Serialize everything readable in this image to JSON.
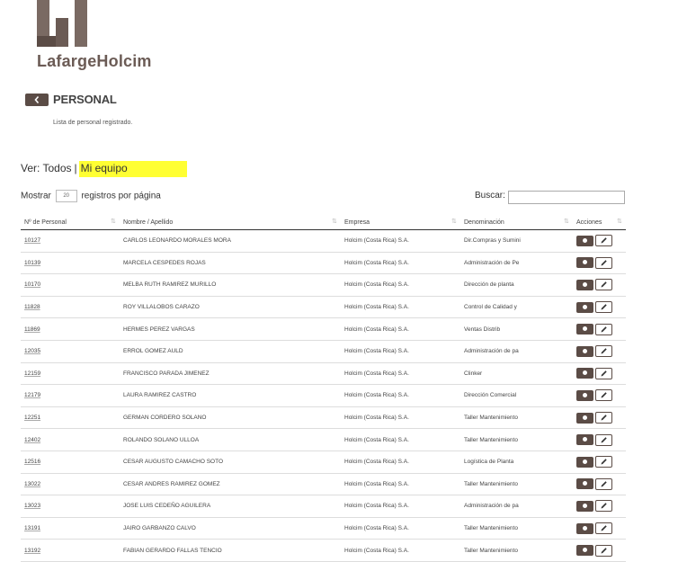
{
  "brand": {
    "name": "LafargeHolcim",
    "color": "#6b5b55",
    "accent": "#5b4c46"
  },
  "header": {
    "back_icon": "chevron-left-icon",
    "title": "PERSONAL",
    "subtitle": "Lista de personal registrado."
  },
  "filter": {
    "prefix": "Ver:",
    "all": "Todos",
    "separator": "|",
    "mine": "Mi equipo",
    "highlight": "#ffff33"
  },
  "length": {
    "before": "Mostrar",
    "value": "20",
    "after": "registros por página"
  },
  "search": {
    "label": "Buscar:",
    "value": ""
  },
  "table": {
    "columns": [
      "Nº de Personal",
      "Nombre / Apellido",
      "Empresa",
      "Denominación",
      "Acciones"
    ],
    "rows": [
      {
        "id": "10127",
        "name": "CARLOS LEONARDO MORALES MORA",
        "company": "Holcim (Costa Rica) S.A.",
        "denom": "Dir.Compras y Sumini"
      },
      {
        "id": "10139",
        "name": "MARCELA CESPEDES ROJAS",
        "company": "Holcim (Costa Rica) S.A.",
        "denom": "Administración de Pe"
      },
      {
        "id": "10170",
        "name": "MELBA RUTH RAMIREZ MURILLO",
        "company": "Holcim (Costa Rica) S.A.",
        "denom": "Dirección de planta"
      },
      {
        "id": "11828",
        "name": "ROY VILLALOBOS CARAZO",
        "company": "Holcim (Costa Rica) S.A.",
        "denom": "Control de Calidad y"
      },
      {
        "id": "11869",
        "name": "HERMES PEREZ VARGAS",
        "company": "Holcim (Costa Rica) S.A.",
        "denom": "Ventas Distrib"
      },
      {
        "id": "12035",
        "name": "ERROL GOMEZ AULD",
        "company": "Holcim (Costa Rica) S.A.",
        "denom": "Administración de pa"
      },
      {
        "id": "12159",
        "name": "FRANCISCO PARADA JIMENEZ",
        "company": "Holcim (Costa Rica) S.A.",
        "denom": "Clinker"
      },
      {
        "id": "12179",
        "name": "LAURA RAMIREZ CASTRO",
        "company": "Holcim (Costa Rica) S.A.",
        "denom": "Dirección Comercial"
      },
      {
        "id": "12251",
        "name": "GERMAN CORDERO SOLANO",
        "company": "Holcim (Costa Rica) S.A.",
        "denom": "Taller Mantenimiento"
      },
      {
        "id": "12402",
        "name": "ROLANDO SOLANO ULLOA",
        "company": "Holcim (Costa Rica) S.A.",
        "denom": "Taller Mantenimiento"
      },
      {
        "id": "12516",
        "name": "CESAR AUGUSTO CAMACHO SOTO",
        "company": "Holcim (Costa Rica) S.A.",
        "denom": "Logística de Planta"
      },
      {
        "id": "13022",
        "name": "CESAR ANDRES RAMIREZ GOMEZ",
        "company": "Holcim (Costa Rica) S.A.",
        "denom": "Taller Mantenimiento"
      },
      {
        "id": "13023",
        "name": "JOSE LUIS CEDEÑO AGUILERA",
        "company": "Holcim (Costa Rica) S.A.",
        "denom": "Administración de pa"
      },
      {
        "id": "13191",
        "name": "JAIRO GARBANZO CALVO",
        "company": "Holcim (Costa Rica) S.A.",
        "denom": "Taller Mantenimiento"
      },
      {
        "id": "13192",
        "name": "FABIAN GERARDO FALLAS TENCIO",
        "company": "Holcim (Costa Rica) S.A.",
        "denom": "Taller Mantenimiento"
      }
    ]
  },
  "actions": {
    "view_icon": "view-icon",
    "edit_icon": "pencil-icon"
  }
}
